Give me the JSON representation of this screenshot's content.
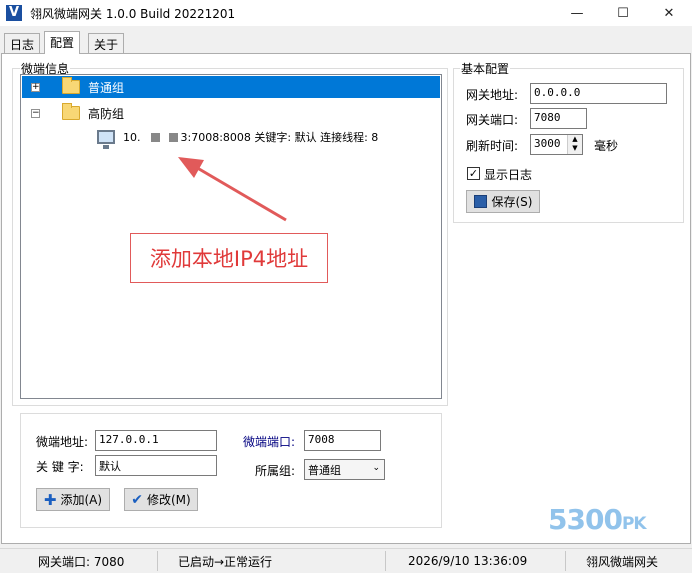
{
  "window": {
    "title": "翎风微端网关 1.0.0 Build 20221201",
    "app_icon": "V",
    "minimize": "—",
    "maximize": "☐",
    "close": "✕"
  },
  "tabs": [
    {
      "label": "日志"
    },
    {
      "label": "配置"
    },
    {
      "label": "关于"
    }
  ],
  "micro_info": {
    "label": "微端信息",
    "tree": [
      {
        "label": "普通组",
        "expander": "+"
      },
      {
        "label": "高防组",
        "expander": "−"
      },
      {
        "label_prefix": "10.",
        "label_suffix": "3:7008:8008 关键字: 默认 连接线程: 8"
      }
    ]
  },
  "basic_config": {
    "label": "基本配置",
    "gateway_addr_label": "网关地址:",
    "gateway_addr_value": "0.0.0.0",
    "gateway_port_label": "网关端口:",
    "gateway_port_value": "7080",
    "refresh_label": "刷新时间:",
    "refresh_value": "3000",
    "refresh_unit": "毫秒",
    "show_log_label": "显示日志",
    "save_label": "保存(S)"
  },
  "edit": {
    "addr_label": "微端地址:",
    "addr_value": "127.0.0.1",
    "port_label": "微端端口:",
    "port_value": "7008",
    "keyword_label": "关 键 字:",
    "keyword_value": "默认",
    "group_label": "所属组:",
    "group_value": "普通组",
    "add_label": "添加(A)",
    "modify_label": "修改(M)"
  },
  "annotation": {
    "text": "添加本地IP4地址",
    "color": "#e03a3a"
  },
  "watermark": {
    "main": "5300",
    "suffix": "PK"
  },
  "status": {
    "port": "网关端口: 7080",
    "state": "已启动→正常运行",
    "datetime": "2026/9/10 13:36:09",
    "app": "翎风微端网关"
  },
  "colors": {
    "selection": "#0078d7",
    "accent_label": "#000080"
  }
}
